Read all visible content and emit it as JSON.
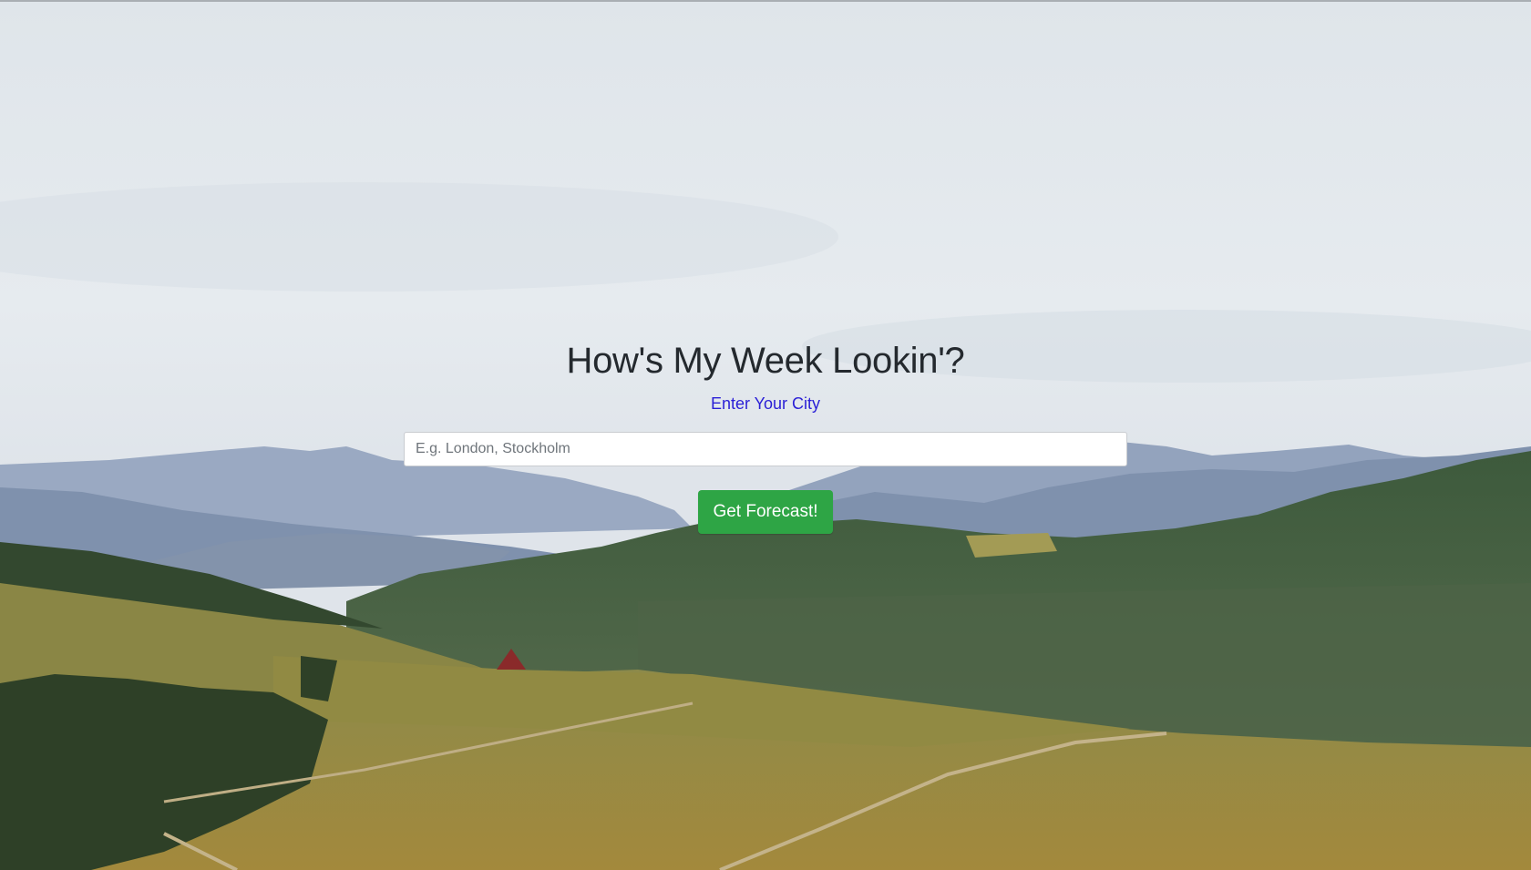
{
  "header": {
    "title": "How's My Week Lookin'?",
    "subtitle": "Enter Your City"
  },
  "search": {
    "placeholder": "E.g. London, Stockholm",
    "value": ""
  },
  "actions": {
    "submit_label": "Get Forecast!"
  },
  "colors": {
    "subtitle": "#2a1fd6",
    "button": "#2ea545",
    "title": "#24292e"
  },
  "background": {
    "description_icon": "mountain-landscape-photo"
  }
}
